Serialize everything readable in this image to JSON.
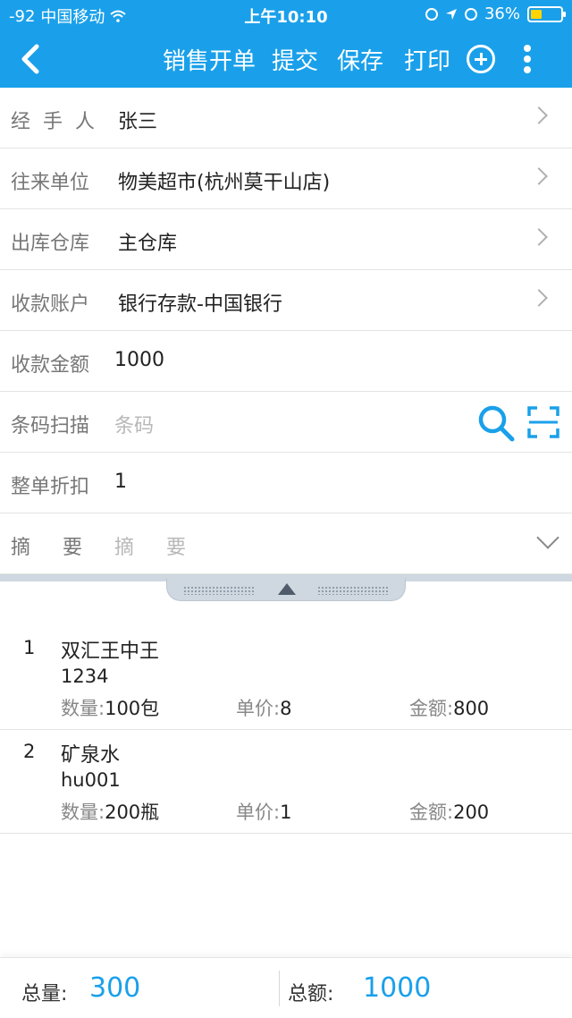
{
  "status_bar": {
    "signal": "-92",
    "carrier": "中国移动",
    "time": "上午10:10",
    "battery": "36%"
  },
  "nav": {
    "title": "销售开单",
    "submit": "提交",
    "save": "保存",
    "print": "打印",
    "icons": [
      "back-icon",
      "plus-icon",
      "more-icon"
    ]
  },
  "form": {
    "handler": {
      "label": "经手人",
      "value": "张三"
    },
    "partner": {
      "label": "往来单位",
      "value": "物美超市(杭州莫干山店)"
    },
    "warehouse": {
      "label": "出库仓库",
      "value": "主仓库"
    },
    "account": {
      "label": "收款账户",
      "value": "银行存款-中国银行"
    },
    "amount": {
      "label": "收款金额",
      "value": "1000"
    },
    "barcode": {
      "label": "条码扫描",
      "placeholder": "条码"
    },
    "discount": {
      "label": "整单折扣",
      "value": "1"
    },
    "memo": {
      "label": "摘要",
      "placeholder": "摘要"
    }
  },
  "items": [
    {
      "index": "1",
      "name": "双汇王中王",
      "code": "1234",
      "qty_label": "数量:",
      "qty": "100包",
      "price_label": "单价:",
      "price": "8",
      "amount_label": "金额:",
      "amount": "800"
    },
    {
      "index": "2",
      "name": "矿泉水",
      "code": "hu001",
      "qty_label": "数量:",
      "qty": "200瓶",
      "price_label": "单价:",
      "price": "1",
      "amount_label": "金额:",
      "amount": "200"
    }
  ],
  "footer": {
    "total_qty_label": "总量:",
    "total_qty": "300",
    "total_amount_label": "总额:",
    "total_amount": "1000"
  },
  "colors": {
    "accent": "#1aa0ea"
  }
}
